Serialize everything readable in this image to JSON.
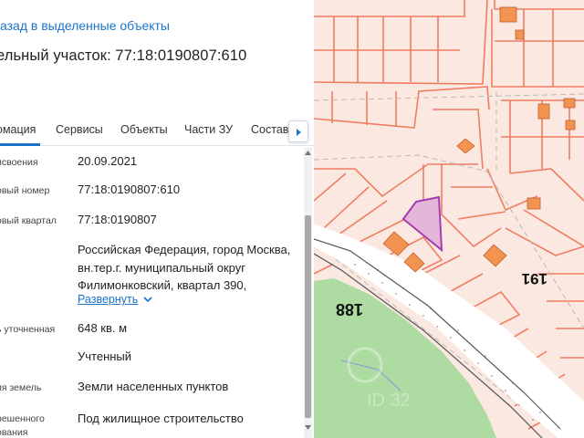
{
  "panel": {
    "back_link": "азад в выделенные объекты",
    "title": "ельный участок: 77:18:0190807:610",
    "tabs": [
      {
        "label": "омация",
        "active": true
      },
      {
        "label": "Сервисы",
        "active": false
      },
      {
        "label": "Объекты",
        "active": false
      },
      {
        "label": "Части ЗУ",
        "active": false
      },
      {
        "label": "Состав",
        "active": false
      }
    ],
    "rows": [
      {
        "label": "исвоения",
        "value": "20.09.2021"
      },
      {
        "label": "овый номер",
        "value": "77:18:0190807:610"
      },
      {
        "label": "овый квартал",
        "value": "77:18:0190807"
      },
      {
        "label": "",
        "value": "Российская Федерация, город Москва, вн.тер.г. муниципальный округ Филимонковский, квартал 390,"
      },
      {
        "label": "ь уточненная",
        "value": "648 кв. м"
      },
      {
        "label": "",
        "value": "Учтенный"
      },
      {
        "label": "ия земель",
        "value": "Земли населенных пунктов"
      },
      {
        "label": "решенного",
        "value": "Под жилищное строительство"
      }
    ],
    "row_label_extra": "ования",
    "expand_label": "Развернуть"
  },
  "map": {
    "labels": [
      "188",
      "191"
    ],
    "watermark_text": "ID 32",
    "parcel_line_color": "#f07d62",
    "highlight_color": "#e6b6da",
    "highlight_border": "#a43eb0",
    "building_color": "#f2944f",
    "forest_color": "#aedba2"
  },
  "colors": {
    "accent": "#1a73c9"
  }
}
